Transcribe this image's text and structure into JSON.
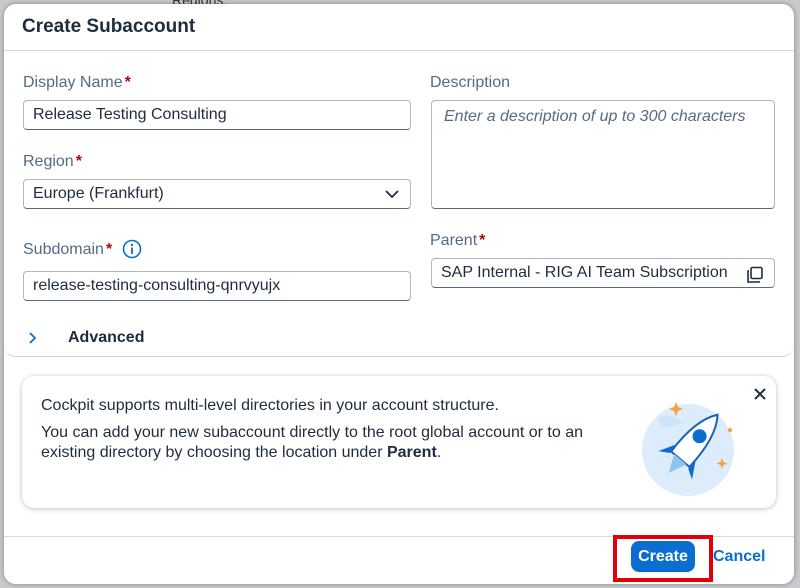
{
  "background": {
    "peek_text": "Regions:"
  },
  "dialog": {
    "title": "Create Subaccount"
  },
  "form": {
    "display_name": {
      "label": "Display Name",
      "required_mark": "*",
      "value": "Release Testing Consulting"
    },
    "description": {
      "label": "Description",
      "placeholder": "Enter a description of up to 300 characters"
    },
    "region": {
      "label": "Region",
      "required_mark": "*",
      "value": "Europe (Frankfurt)"
    },
    "subdomain": {
      "label": "Subdomain",
      "required_mark": "*",
      "value": "release-testing-consulting-qnrvyujx"
    },
    "parent": {
      "label": "Parent",
      "required_mark": "*",
      "value": "SAP Internal - RIG AI Team Subscription"
    },
    "advanced": {
      "label": "Advanced"
    }
  },
  "info_card": {
    "line1": "Cockpit supports multi-level directories in your account structure.",
    "line2_prefix": "You can add your new subaccount directly to the root global account or to an existing directory by choosing the location under ",
    "line2_bold": "Parent",
    "line2_suffix": "."
  },
  "footer": {
    "create_label": "Create",
    "cancel_label": "Cancel"
  },
  "colors": {
    "accent": "#0a6ed1",
    "required": "#aa0808",
    "highlight": "#e0000b"
  },
  "icons": {
    "region_dropdown": "chevron-down-icon",
    "subdomain_info": "info-icon",
    "parent_copy": "copy-icon",
    "advanced_expand": "chevron-right-icon",
    "card_close": "close-icon",
    "illustration": "rocket-illustration"
  }
}
